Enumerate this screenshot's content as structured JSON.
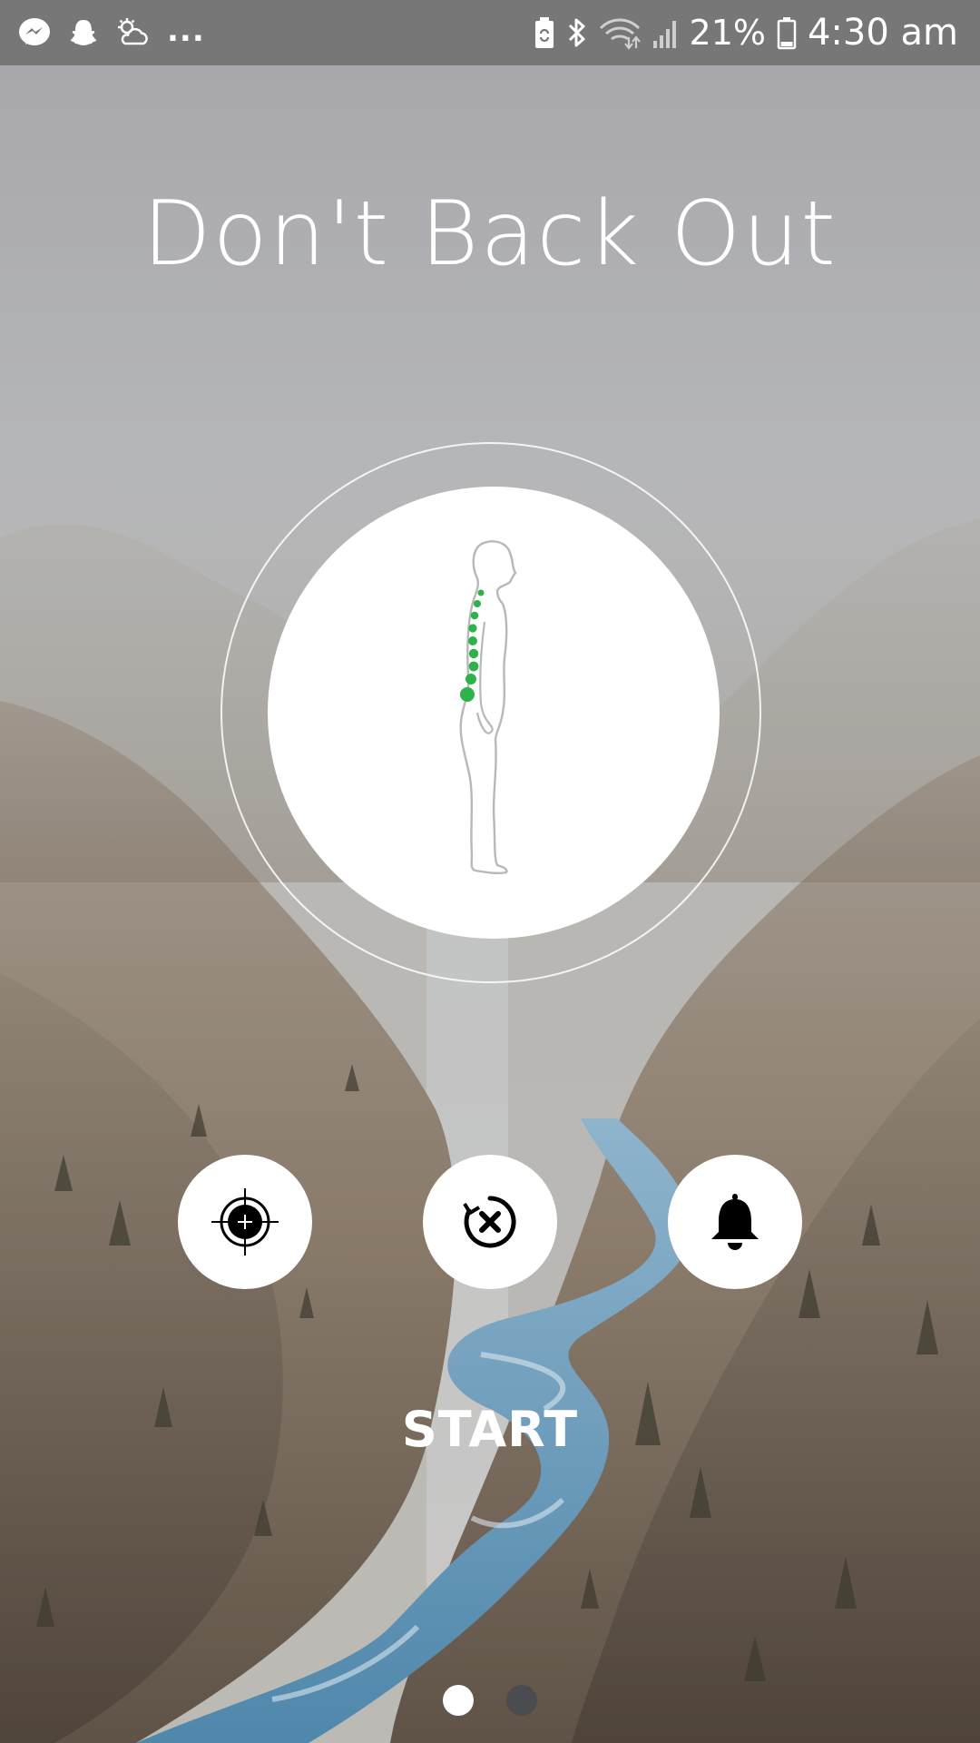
{
  "status_bar": {
    "left_icons": [
      "messenger-icon",
      "snapchat-icon",
      "weather-cloud-icon"
    ],
    "overflow": "...",
    "right_icons": [
      "battery-saver-icon",
      "bluetooth-icon",
      "wifi-icon",
      "signal-icon"
    ],
    "battery_percent": "21%",
    "time": "4:30 am"
  },
  "app": {
    "title": "Don't Back Out"
  },
  "posture": {
    "figure": "standing-side-profile",
    "spine_color": "#2db34a"
  },
  "actions": {
    "target_icon": "crosshair-icon",
    "cancel_icon": "cancel-rotate-icon",
    "bell_icon": "bell-icon"
  },
  "start": {
    "label": "START"
  },
  "pager": {
    "pages": 2,
    "active_index": 0
  },
  "colors": {
    "status_bar": "#777777",
    "sky": "#a9a9ad",
    "river": "#6ea3c4",
    "accent_green": "#2db34a"
  }
}
